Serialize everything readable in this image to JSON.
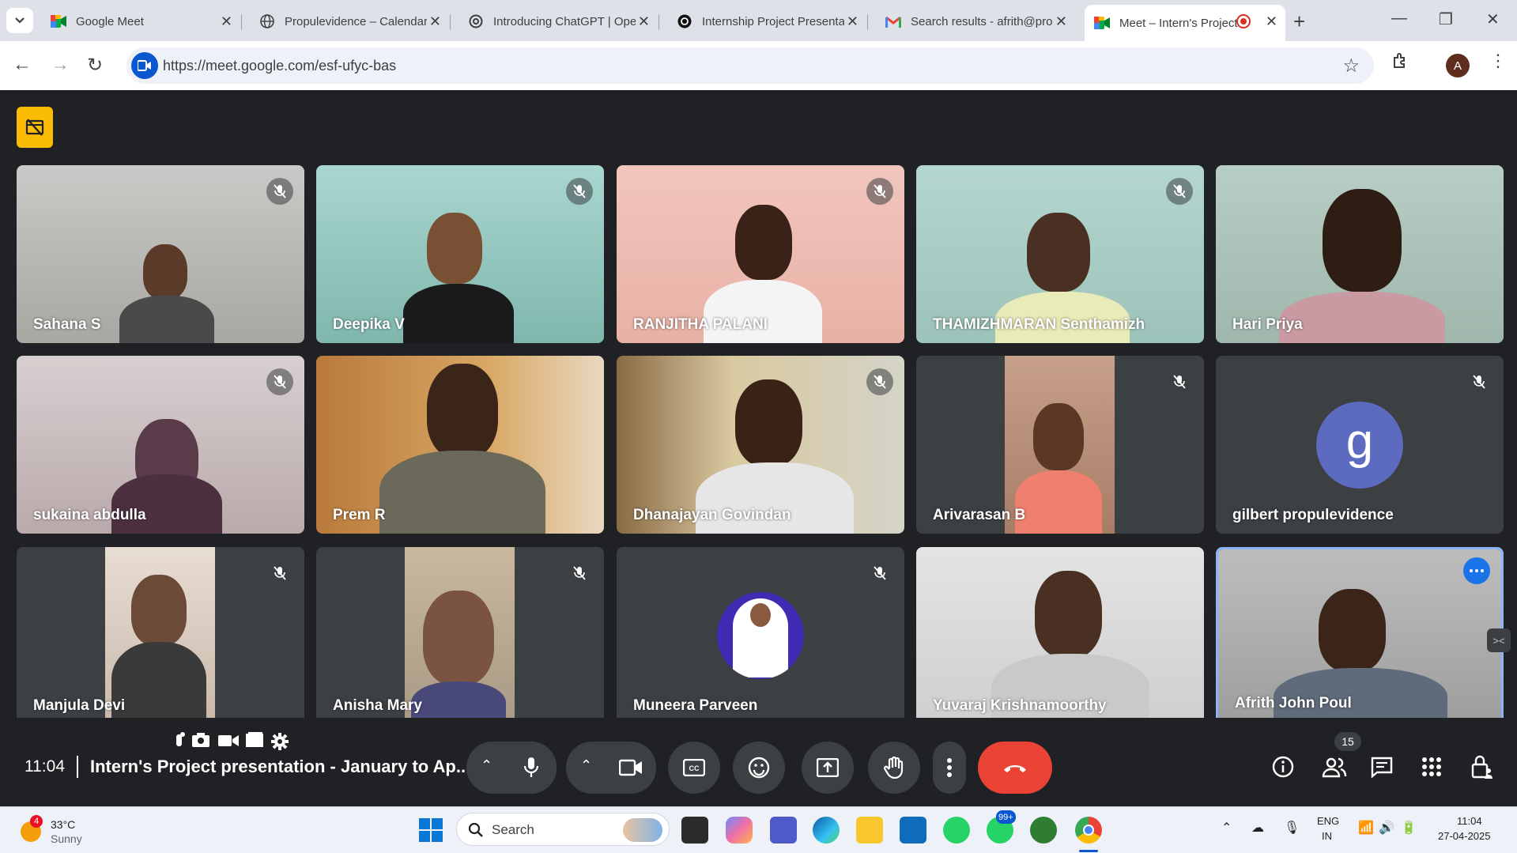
{
  "browser": {
    "tabs": [
      {
        "title": "Google Meet",
        "icon": "google-meet-icon"
      },
      {
        "title": "Propulevidence – Calendar",
        "icon": "globe-icon"
      },
      {
        "title": "Introducing ChatGPT | Ope",
        "icon": "openai-icon"
      },
      {
        "title": "Internship Project Presenta",
        "icon": "openai-icon"
      },
      {
        "title": "Search results - afrith@pro",
        "icon": "gmail-icon"
      },
      {
        "title": "Meet – Intern's Project",
        "icon": "google-meet-icon",
        "active": true
      }
    ],
    "new_tab": "+",
    "url": "https://meet.google.com/esf-ufyc-bas",
    "profile_initial": "A"
  },
  "meet": {
    "participants": [
      {
        "name": "Sahana S"
      },
      {
        "name": "Deepika V"
      },
      {
        "name": "RANJITHA PALANI"
      },
      {
        "name": "THAMIZHMARAN Senthamizh"
      },
      {
        "name": "Hari Priya"
      },
      {
        "name": "sukaina abdulla"
      },
      {
        "name": "Prem R"
      },
      {
        "name": "Dhanajayan Govindan"
      },
      {
        "name": "Arivarasan B"
      },
      {
        "name": "gilbert propulevidence",
        "avatar_letter": "g"
      },
      {
        "name": "Manjula Devi"
      },
      {
        "name": "Anisha Mary"
      },
      {
        "name": "Muneera Parveen"
      },
      {
        "name": "Yuvaraj Krishnamoorthy"
      },
      {
        "name": "Afrith John Poul"
      }
    ],
    "clock": "11:04",
    "meeting_title": "Intern's Project presentation - January to Ap...",
    "participant_count": "15",
    "colors": {
      "hangup": "#ea4335",
      "active_speaker": "#8ab4f8",
      "record_badge": "#fbbc04"
    }
  },
  "taskbar": {
    "weather": {
      "badge": "4",
      "temp": "33°C",
      "condition": "Sunny"
    },
    "search_placeholder": "Search",
    "whatsapp_badge": "99+",
    "lang": "ENG",
    "region": "IN",
    "time": "11:04",
    "date": "27-04-2025"
  }
}
